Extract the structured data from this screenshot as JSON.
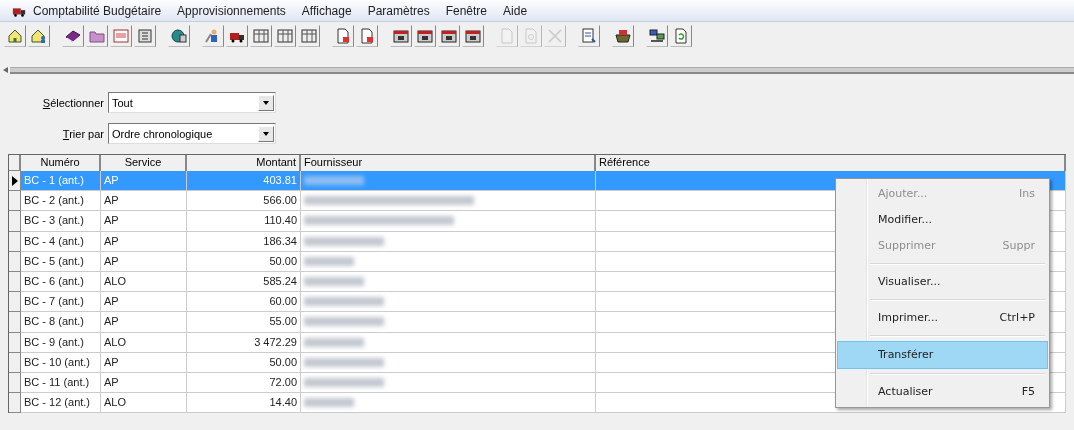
{
  "menu_bar": {
    "items": [
      {
        "label": "Comptabilité Budgétaire"
      },
      {
        "label": "Approvisionnements"
      },
      {
        "label": "Affichage"
      },
      {
        "label": "Paramètres"
      },
      {
        "label": "Fenêtre"
      },
      {
        "label": "Aide"
      }
    ]
  },
  "toolbar": {
    "groups": [
      [
        {
          "kind": "house",
          "disabled": false
        },
        {
          "kind": "house-person",
          "disabled": false
        }
      ],
      [
        {
          "kind": "book",
          "disabled": false
        },
        {
          "kind": "folder",
          "disabled": false
        },
        {
          "kind": "text",
          "disabled": false
        },
        {
          "kind": "ledger",
          "disabled": false
        }
      ],
      [
        {
          "kind": "globe",
          "disabled": false
        }
      ],
      [
        {
          "kind": "person",
          "disabled": false
        },
        {
          "kind": "truck",
          "disabled": false
        },
        {
          "kind": "grid",
          "disabled": false
        },
        {
          "kind": "grid",
          "disabled": false
        },
        {
          "kind": "grid",
          "disabled": false
        }
      ],
      [
        {
          "kind": "doc-red",
          "disabled": false
        },
        {
          "kind": "doc-red",
          "disabled": false
        }
      ],
      [
        {
          "kind": "calendar",
          "disabled": false
        },
        {
          "kind": "calendar",
          "disabled": false
        },
        {
          "kind": "calendar",
          "disabled": false
        },
        {
          "kind": "calendar",
          "disabled": false
        }
      ],
      [
        {
          "kind": "page",
          "disabled": true
        },
        {
          "kind": "page-search",
          "disabled": true
        },
        {
          "kind": "cross",
          "disabled": true
        }
      ],
      [
        {
          "kind": "report",
          "disabled": false
        }
      ],
      [
        {
          "kind": "basket",
          "disabled": false
        }
      ],
      [
        {
          "kind": "computers",
          "disabled": false
        },
        {
          "kind": "refresh",
          "disabled": false
        }
      ]
    ]
  },
  "filters": [
    {
      "label": "Sélectionner",
      "value": "Tout"
    },
    {
      "label": "Trier par",
      "value": "Ordre chronologique"
    }
  ],
  "table": {
    "columns": [
      {
        "label": "Numéro"
      },
      {
        "label": "Service"
      },
      {
        "label": "Montant"
      },
      {
        "label": "Fournisseur"
      },
      {
        "label": "Référence"
      }
    ],
    "rows": [
      {
        "numero": "BC - 1 (ant.)",
        "service": "AP",
        "montant": "403.81",
        "selected": true
      },
      {
        "numero": "BC - 2 (ant.)",
        "service": "AP",
        "montant": "566.00",
        "selected": false
      },
      {
        "numero": "BC - 3 (ant.)",
        "service": "AP",
        "montant": "110.40",
        "selected": false
      },
      {
        "numero": "BC - 4 (ant.)",
        "service": "AP",
        "montant": "186.34",
        "selected": false
      },
      {
        "numero": "BC - 5 (ant.)",
        "service": "AP",
        "montant": "50.00",
        "selected": false
      },
      {
        "numero": "BC - 6 (ant.)",
        "service": "ALO",
        "montant": "585.24",
        "selected": false
      },
      {
        "numero": "BC - 7 (ant.)",
        "service": "AP",
        "montant": "60.00",
        "selected": false
      },
      {
        "numero": "BC - 8 (ant.)",
        "service": "AP",
        "montant": "55.00",
        "selected": false
      },
      {
        "numero": "BC - 9 (ant.)",
        "service": "ALO",
        "montant": "3 472.29",
        "selected": false
      },
      {
        "numero": "BC - 10 (ant.)",
        "service": "AP",
        "montant": "50.00",
        "selected": false
      },
      {
        "numero": "BC - 11 (ant.)",
        "service": "AP",
        "montant": "72.00",
        "selected": false
      },
      {
        "numero": "BC - 12 (ant.)",
        "service": "ALO",
        "montant": "14.40",
        "selected": false
      }
    ]
  },
  "context_menu": {
    "items": [
      {
        "kind": "item",
        "label": "Ajouter...",
        "shortcut": "Ins",
        "disabled": true,
        "selected": false
      },
      {
        "kind": "item",
        "label": "Modifier...",
        "disabled": false,
        "selected": false
      },
      {
        "kind": "item",
        "label": "Supprimer",
        "shortcut": "Suppr",
        "disabled": true,
        "selected": false
      },
      {
        "kind": "separator"
      },
      {
        "kind": "item",
        "label": "Visualiser...",
        "disabled": false,
        "selected": false
      },
      {
        "kind": "separator"
      },
      {
        "kind": "item",
        "label": "Imprimer...",
        "shortcut": "Ctrl+P",
        "disabled": false,
        "selected": false
      },
      {
        "kind": "separator"
      },
      {
        "kind": "item",
        "label": "Transférer",
        "disabled": false,
        "selected": true
      },
      {
        "kind": "separator"
      },
      {
        "kind": "item",
        "label": "Actualiser",
        "shortcut": "F5",
        "disabled": false,
        "selected": false
      }
    ]
  }
}
